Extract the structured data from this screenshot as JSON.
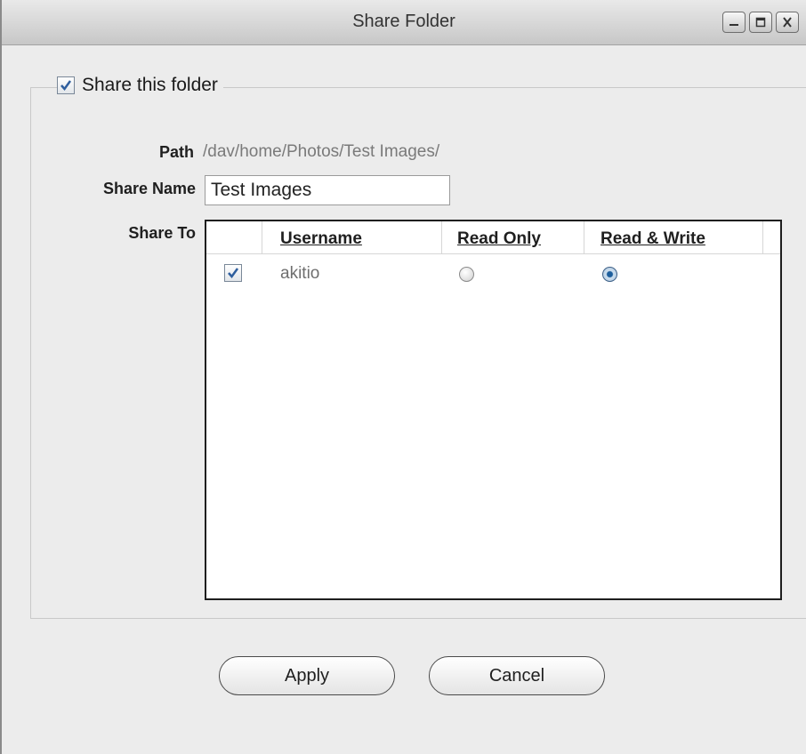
{
  "window": {
    "title": "Share Folder"
  },
  "share": {
    "share_this_folder_label": "Share this folder",
    "share_this_folder_checked": true,
    "path_label": "Path",
    "path_value": "/dav/home/Photos/Test Images/",
    "share_name_label": "Share Name",
    "share_name_value": "Test Images",
    "share_to_label": "Share To"
  },
  "table": {
    "headers": [
      "Username",
      "Read Only",
      "Read & Write"
    ],
    "rows": [
      {
        "checked": true,
        "username": "akitio",
        "permission": "Read & Write"
      }
    ]
  },
  "buttons": {
    "apply": "Apply",
    "cancel": "Cancel"
  },
  "icons": {
    "minimize": "minimize-icon",
    "maximize": "maximize-icon",
    "close": "close-icon",
    "checkbox": "checkbox-checked-icon",
    "radio_on": "radio-selected-icon",
    "radio_off": "radio-unselected-icon"
  },
  "colors": {
    "accent": "#1d5e9c",
    "checkmark": "#2f5f9e"
  }
}
